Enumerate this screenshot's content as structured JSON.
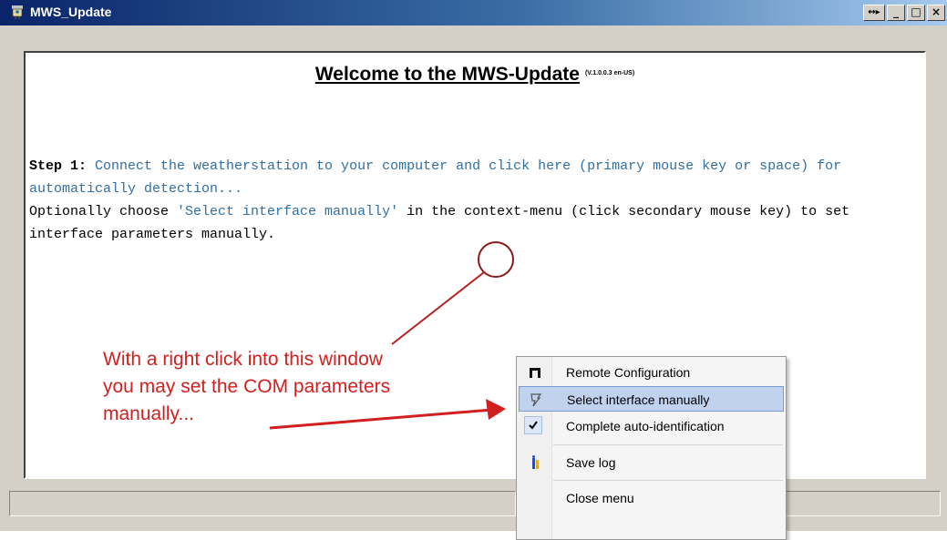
{
  "window": {
    "title": "MWS_Update",
    "buttons": [
      "↔▸",
      "_",
      "□",
      "×"
    ]
  },
  "content": {
    "welcome_title": "Welcome to the MWS-Update",
    "version": "(V.1.0.0.3 en-US)",
    "step_label": "Step 1:",
    "step_text": " Connect the weatherstation to your computer and click here (primary mouse key or space) for automatically detection...",
    "optional_prefix": "Optionally choose ",
    "optional_quoted": "'Select interface manually'",
    "optional_suffix": " in the context-menu (click secondary mouse key) to set interface parameters manually."
  },
  "annotation": {
    "text": "With a right click into this window\nyou may set the COM parameters\nmanually..."
  },
  "context_menu": {
    "items": [
      {
        "label": "Remote Configuration",
        "icon": "remote-config-icon"
      },
      {
        "label": "Select interface manually",
        "icon": "interface-icon",
        "highlighted": true
      },
      {
        "label": "Complete auto-identification",
        "icon": "checkmark-icon",
        "checked": true
      },
      {
        "label": "Save log",
        "icon": "save-log-icon"
      },
      {
        "label": "Close menu",
        "icon": ""
      }
    ]
  },
  "colors": {
    "annotation": "#d21f1f",
    "step_text": "#2f6fa3",
    "menu_highlight": "#c1d2ee"
  }
}
